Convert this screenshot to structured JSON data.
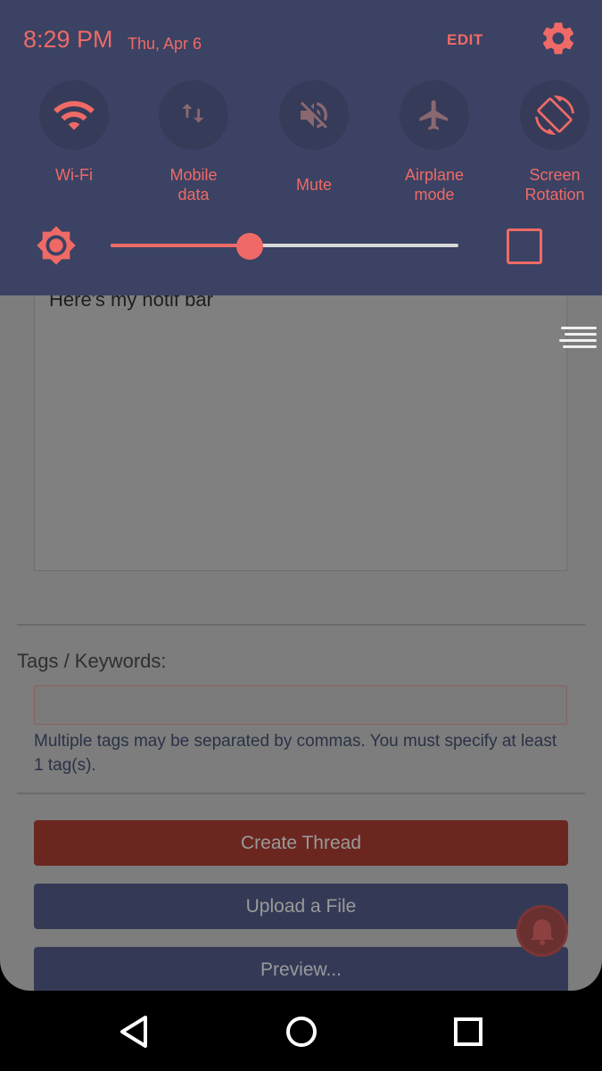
{
  "statusbar": {
    "time": "8:29 PM",
    "date": "Thu, Apr 6",
    "edit_label": "EDIT",
    "settings_icon": "gear-icon"
  },
  "quick_tiles": [
    {
      "label": "Wi-Fi",
      "icon": "wifi-icon"
    },
    {
      "label": "Mobile\ndata",
      "icon": "mobile-data-icon"
    },
    {
      "label": "Mute",
      "icon": "mute-icon"
    },
    {
      "label": "Airplane\nmode",
      "icon": "airplane-icon"
    },
    {
      "label": "Screen\nRotation",
      "icon": "screen-rotation-icon"
    }
  ],
  "brightness": {
    "level": 0.4,
    "icon": "brightness-icon",
    "auto_icon": "auto-brightness-checkbox"
  },
  "page": {
    "body_text": "Here's my notif bar",
    "tags_label": "Tags / Keywords:",
    "tags_value": "",
    "tags_help": "Multiple tags may be separated by commas. You must specify at least 1 tag(s).",
    "create_button": "Create Thread",
    "upload_button": "Upload a File",
    "preview_button": "Preview..."
  },
  "colors": {
    "accent": "#ef6a66",
    "shade_bg": "#3b4263",
    "create_button": "#6b2620",
    "secondary_button": "#343a56"
  },
  "navbar": {
    "back": "back-icon",
    "home": "home-icon",
    "recents": "recents-icon"
  }
}
